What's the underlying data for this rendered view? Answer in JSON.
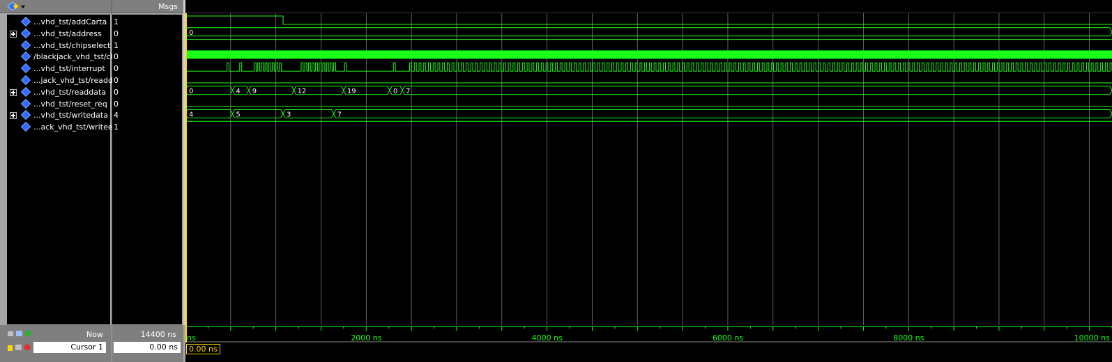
{
  "header": {
    "msgs_label": "Msgs"
  },
  "signals": [
    {
      "name": "...vhd_tst/addCarta",
      "value": "1",
      "expandable": false
    },
    {
      "name": "...vhd_tst/address",
      "value": "0",
      "expandable": true
    },
    {
      "name": "...vhd_tst/chipselect",
      "value": "1",
      "expandable": false
    },
    {
      "name": "/blackjack_vhd_tst/clk",
      "value": "0",
      "expandable": false
    },
    {
      "name": "...vhd_tst/interrupt",
      "value": "0",
      "expandable": false
    },
    {
      "name": "...jack_vhd_tst/readd",
      "value": "0",
      "expandable": false
    },
    {
      "name": "...vhd_tst/readdata",
      "value": "0",
      "expandable": true
    },
    {
      "name": "...vhd_tst/reset_req",
      "value": "0",
      "expandable": false
    },
    {
      "name": "...vhd_tst/writedata",
      "value": "4",
      "expandable": true
    },
    {
      "name": "...ack_vhd_tst/writee",
      "value": "1",
      "expandable": false
    }
  ],
  "footer": {
    "now_label": "Now",
    "now_value": "14400 ns",
    "cursor_label": "Cursor 1",
    "cursor_value": "0.00 ns",
    "cursor_box": "0.00 ns"
  },
  "time_axis": {
    "labels": [
      {
        "text": "ns",
        "ns": 0
      },
      {
        "text": "2000 ns",
        "ns": 2000
      },
      {
        "text": "4000 ns",
        "ns": 4000
      },
      {
        "text": "6000 ns",
        "ns": 6000
      },
      {
        "text": "8000 ns",
        "ns": 8000
      },
      {
        "text": "10000 ns",
        "ns": 10000
      }
    ],
    "range_ns": [
      0,
      10250
    ]
  },
  "bus_values": {
    "address": [
      {
        "ns": 0,
        "v": "0"
      }
    ],
    "readdata": [
      {
        "ns": 0,
        "v": "0"
      },
      {
        "ns": 520,
        "v": "4"
      },
      {
        "ns": 700,
        "v": "9"
      },
      {
        "ns": 1200,
        "v": "12"
      },
      {
        "ns": 1750,
        "v": "19"
      },
      {
        "ns": 2260,
        "v": "0"
      },
      {
        "ns": 2400,
        "v": "7"
      }
    ],
    "writedata": [
      {
        "ns": 0,
        "v": "4"
      },
      {
        "ns": 520,
        "v": "5"
      },
      {
        "ns": 1080,
        "v": "3"
      },
      {
        "ns": 1640,
        "v": "7"
      }
    ]
  },
  "colors": {
    "wave": "#19ff19",
    "cursor": "#ffd400",
    "grid": "#7a7a7a"
  }
}
